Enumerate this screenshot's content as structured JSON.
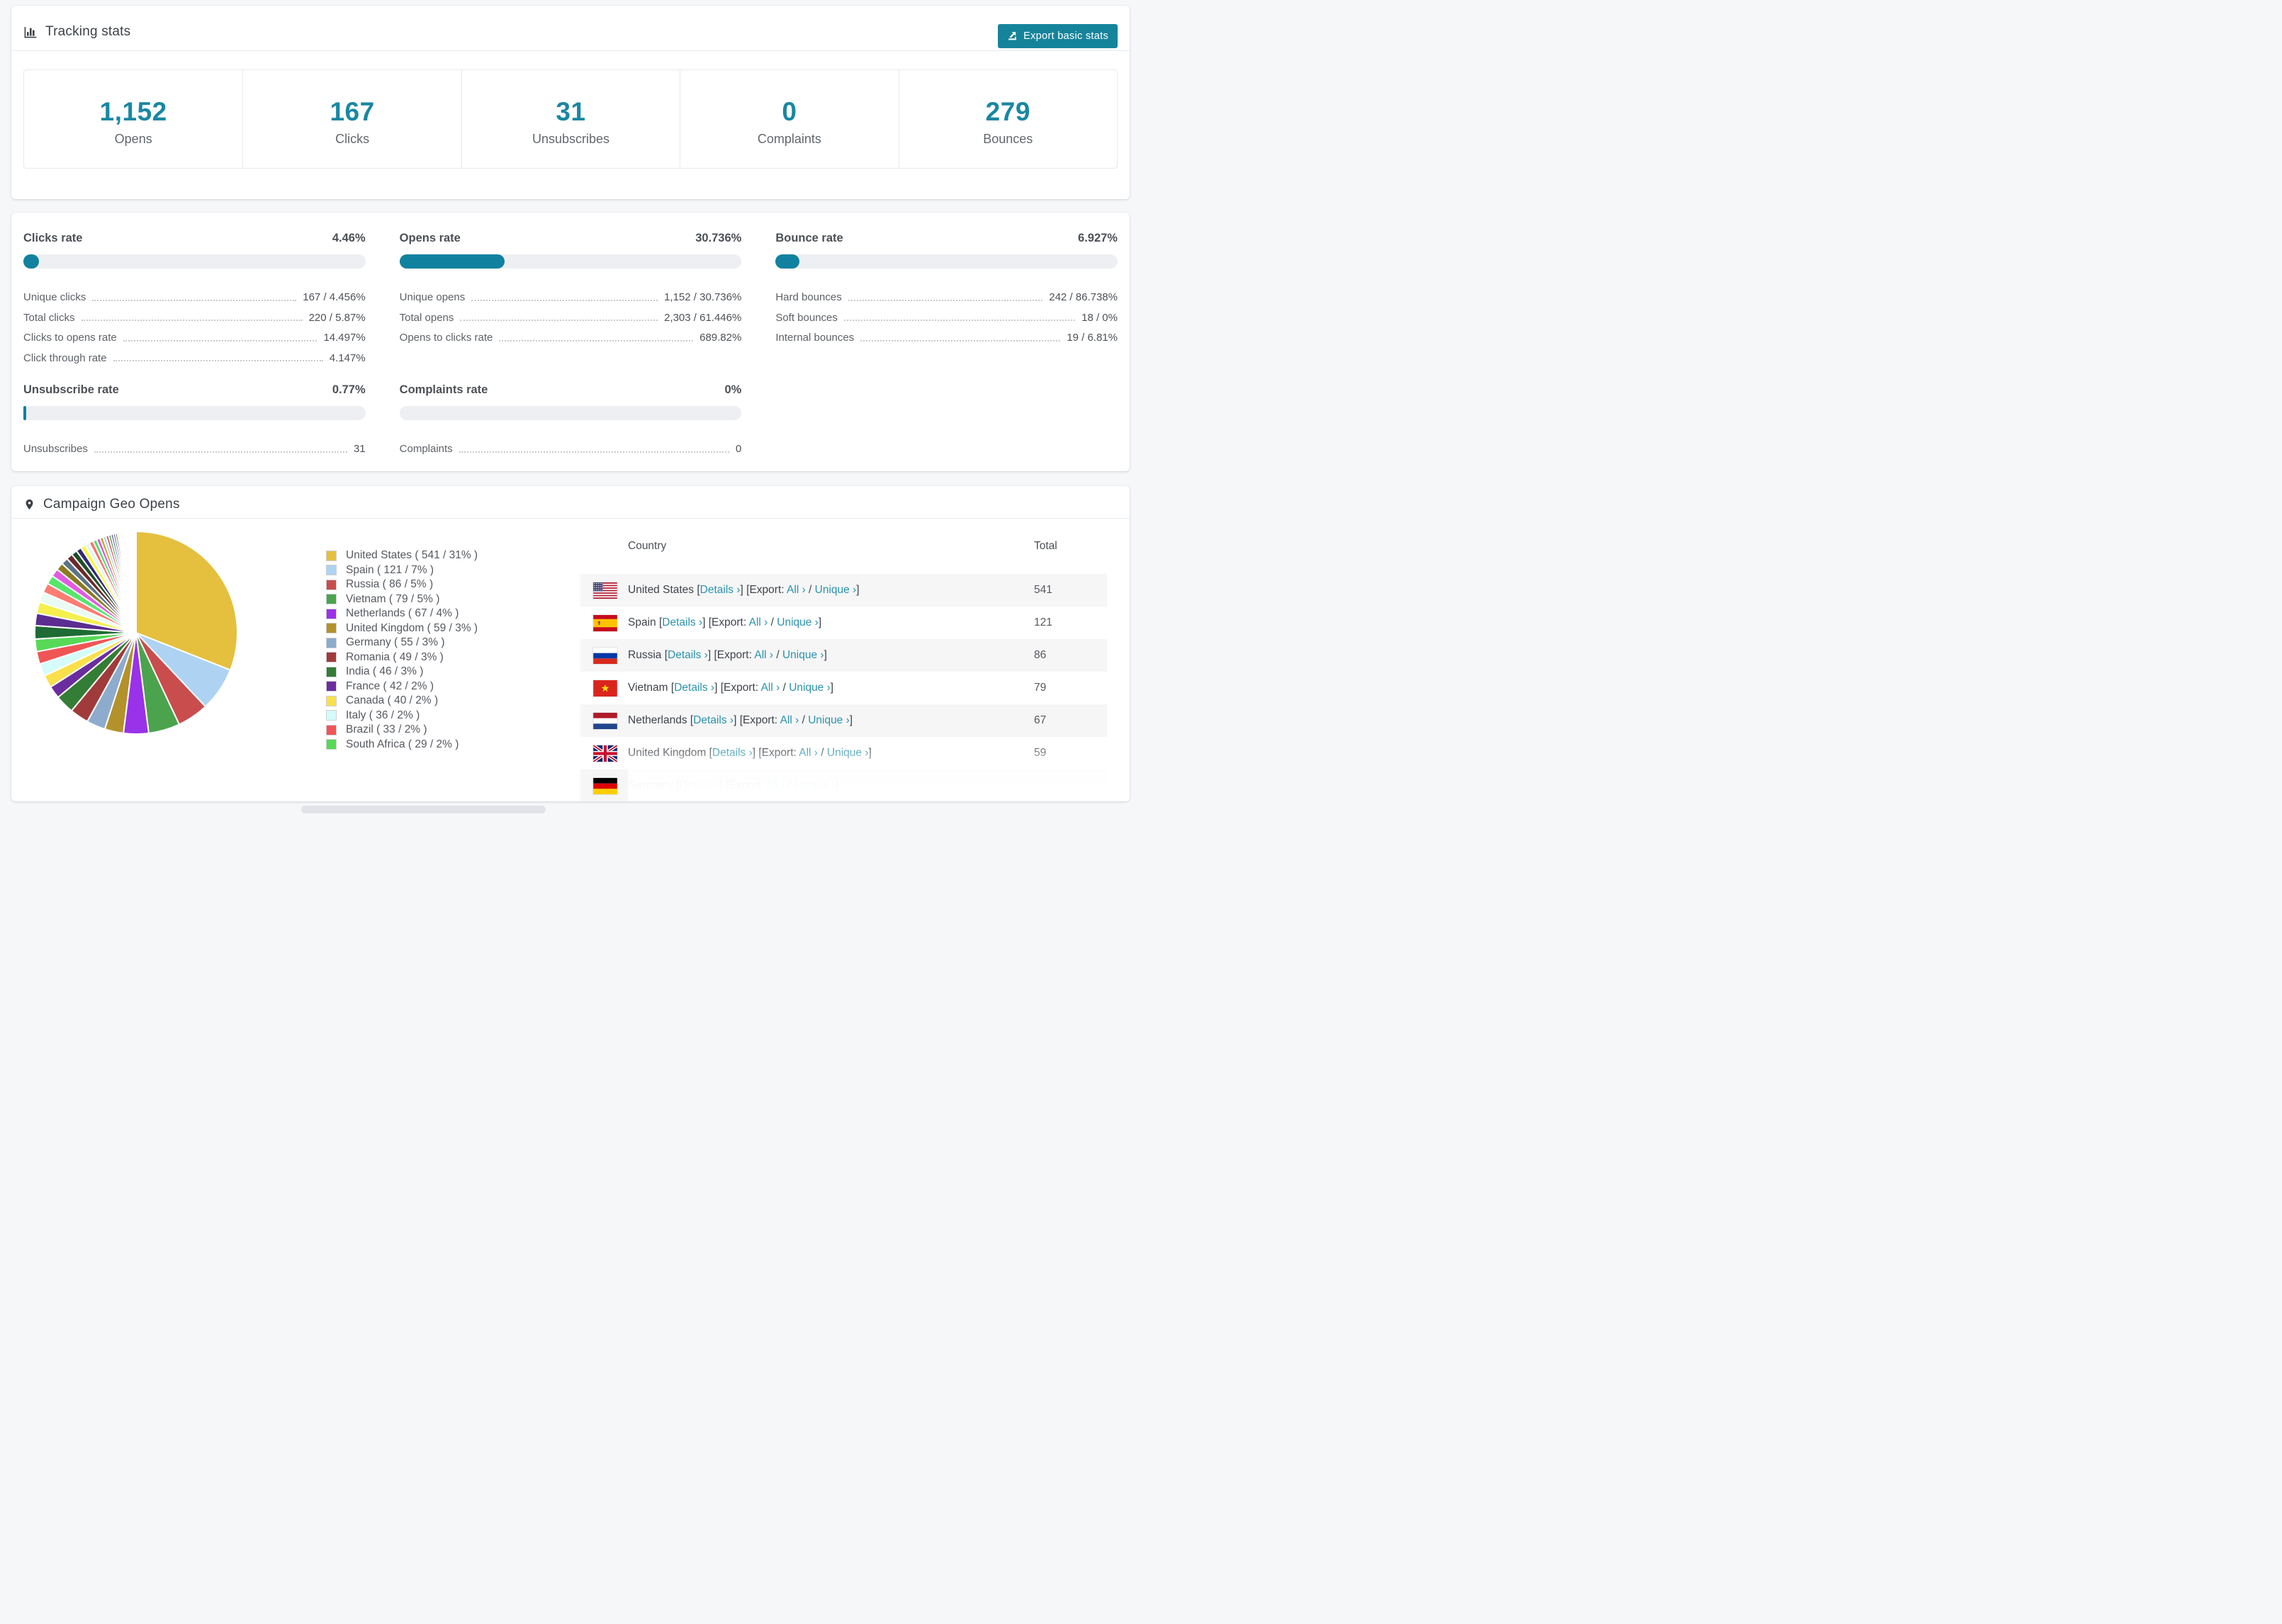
{
  "colors": {
    "accent_teal": "#1a87a2",
    "button_teal": "#15849b",
    "link_teal": "#2b93ab",
    "bar_fill": "#1082a0",
    "bar_track": "#edeff2",
    "row_stripe": "#f6f6f7",
    "page_bg": "#f6f7f9"
  },
  "tracking": {
    "title": "Tracking stats",
    "export_button": "Export basic stats",
    "stats": [
      {
        "value": "1,152",
        "label": "Opens"
      },
      {
        "value": "167",
        "label": "Clicks"
      },
      {
        "value": "31",
        "label": "Unsubscribes"
      },
      {
        "value": "0",
        "label": "Complaints"
      },
      {
        "value": "279",
        "label": "Bounces"
      }
    ]
  },
  "rates": {
    "sections": [
      {
        "title": "Clicks rate",
        "value": "4.46%",
        "percent": 4.46,
        "rows": [
          {
            "label": "Unique clicks",
            "value": "167 / 4.456%"
          },
          {
            "label": "Total clicks",
            "value": "220 / 5.87%"
          },
          {
            "label": "Clicks to opens rate",
            "value": "14.497%"
          },
          {
            "label": "Click through rate",
            "value": "4.147%"
          }
        ]
      },
      {
        "title": "Opens rate",
        "value": "30.736%",
        "percent": 30.736,
        "rows": [
          {
            "label": "Unique opens",
            "value": "1,152 / 30.736%"
          },
          {
            "label": "Total opens",
            "value": "2,303 / 61.446%"
          },
          {
            "label": "Opens to clicks rate",
            "value": "689.82%"
          }
        ]
      },
      {
        "title": "Bounce rate",
        "value": "6.927%",
        "percent": 6.927,
        "rows": [
          {
            "label": "Hard bounces",
            "value": "242 / 86.738%"
          },
          {
            "label": "Soft bounces",
            "value": "18 / 0%"
          },
          {
            "label": "Internal bounces",
            "value": "19 / 6.81%"
          }
        ]
      },
      {
        "title": "Unsubscribe rate",
        "value": "0.77%",
        "percent": 0.77,
        "rows": [
          {
            "label": "Unsubscribes",
            "value": "31"
          }
        ]
      },
      {
        "title": "Complaints rate",
        "value": "0%",
        "percent": 0,
        "rows": [
          {
            "label": "Complaints",
            "value": "0"
          }
        ]
      }
    ]
  },
  "geo": {
    "title": "Campaign Geo Opens",
    "table": {
      "headers": [
        "Country",
        "Total"
      ],
      "details_label": "Details ›",
      "export_prefix": "[Export: ",
      "all_label": "All ›",
      "separator": " / ",
      "unique_label": "Unique ›",
      "rows": [
        {
          "country": "United States",
          "flag": "us",
          "total": "541"
        },
        {
          "country": "Spain",
          "flag": "es",
          "total": "121"
        },
        {
          "country": "Russia",
          "flag": "ru",
          "total": "86"
        },
        {
          "country": "Vietnam",
          "flag": "vn",
          "total": "79"
        },
        {
          "country": "Netherlands",
          "flag": "nl",
          "total": "67"
        },
        {
          "country": "United Kingdom",
          "flag": "gb",
          "total": "59"
        },
        {
          "country": "Germany",
          "flag": "de",
          "total": ""
        }
      ]
    }
  },
  "chart_data": {
    "type": "pie",
    "title": "Campaign Geo Opens",
    "legend_position": "right",
    "legend_format": "{label} ( {count} / {percent}% )",
    "slices": [
      {
        "label": "United States",
        "count": 541,
        "percent": 31,
        "color": "#e5bf3e"
      },
      {
        "label": "Spain",
        "count": 121,
        "percent": 7,
        "color": "#aed3f2"
      },
      {
        "label": "Russia",
        "count": 86,
        "percent": 5,
        "color": "#c94d4d"
      },
      {
        "label": "Vietnam",
        "count": 79,
        "percent": 5,
        "color": "#4ba34e"
      },
      {
        "label": "Netherlands",
        "count": 67,
        "percent": 4,
        "color": "#9932e8"
      },
      {
        "label": "United Kingdom",
        "count": 59,
        "percent": 3,
        "color": "#b3922b"
      },
      {
        "label": "Germany",
        "count": 55,
        "percent": 3,
        "color": "#8dabcc"
      },
      {
        "label": "Romania",
        "count": 49,
        "percent": 3,
        "color": "#a03b3b"
      },
      {
        "label": "India",
        "count": 46,
        "percent": 3,
        "color": "#337d36"
      },
      {
        "label": "France",
        "count": 42,
        "percent": 2,
        "color": "#6b2d9e"
      },
      {
        "label": "Canada",
        "count": 40,
        "percent": 2,
        "color": "#f9e04b"
      },
      {
        "label": "Italy",
        "count": 36,
        "percent": 2,
        "color": "#d6fbfb"
      },
      {
        "label": "Brazil",
        "count": 33,
        "percent": 2,
        "color": "#f05555"
      },
      {
        "label": "South Africa",
        "count": 29,
        "percent": 2,
        "color": "#57d957"
      }
    ],
    "others": {
      "total_percent": 26,
      "count": 45,
      "decay": 0.92,
      "palette": [
        "#1e6b34",
        "#5b2d90",
        "#f5f04e",
        "#e9fbf3",
        "#fd7d72",
        "#57e66b",
        "#e15be1",
        "#8a7a22",
        "#5c7386",
        "#6b2a2a",
        "#1d4f26",
        "#322a73",
        "#f7f74e",
        "#dff7ef",
        "#fd6e6e",
        "#52e06a",
        "#df52df",
        "#c9a227",
        "#a6d3f2",
        "#d94c4c",
        "#43a047",
        "#6a3fbf"
      ]
    }
  }
}
